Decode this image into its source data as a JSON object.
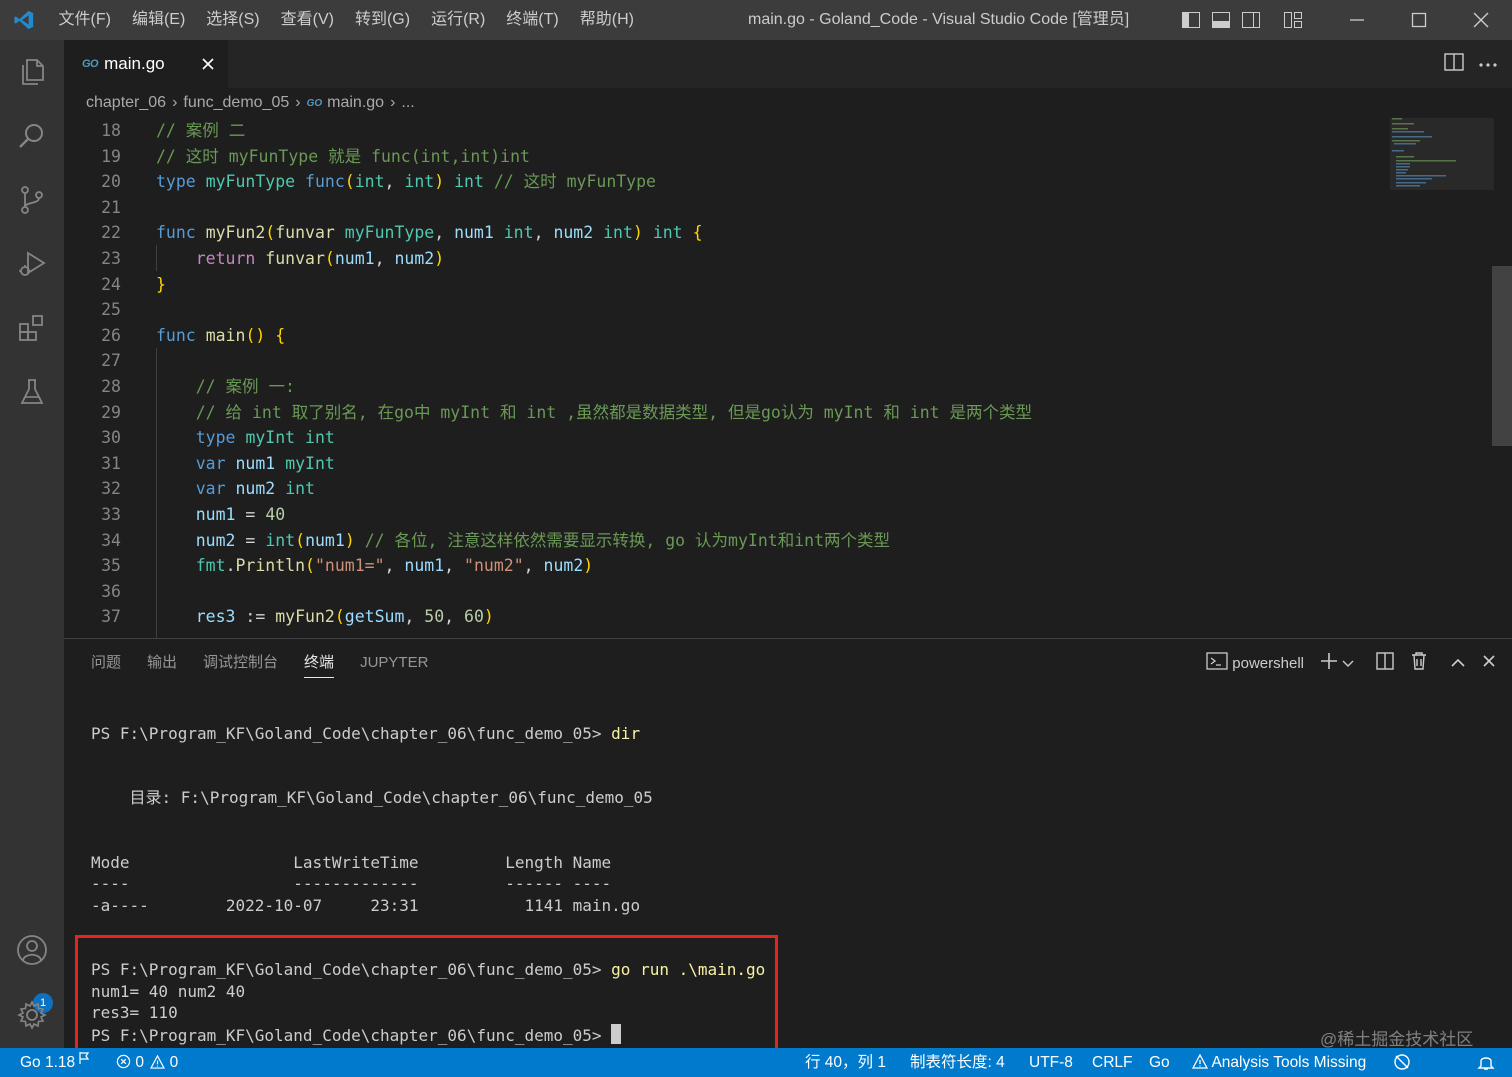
{
  "titlebar": {
    "menu": [
      "文件(F)",
      "编辑(E)",
      "选择(S)",
      "查看(V)",
      "转到(G)",
      "运行(R)",
      "终端(T)",
      "帮助(H)"
    ],
    "title": "main.go - Goland_Code - Visual Studio Code [管理员]"
  },
  "activitybar": {
    "badge": "1"
  },
  "tab": {
    "icon": "GO",
    "label": "main.go"
  },
  "breadcrumb": {
    "parts": [
      "chapter_06",
      "func_demo_05",
      "main.go",
      "..."
    ]
  },
  "editor": {
    "line_numbers": [
      "18",
      "19",
      "20",
      "21",
      "22",
      "23",
      "24",
      "25",
      "26",
      "27",
      "28",
      "29",
      "30",
      "31",
      "32",
      "33",
      "34",
      "35",
      "36",
      "37"
    ],
    "lines": [
      "// 案例 二",
      "// 这时 myFunType 就是 func(int,int)int",
      "type myFunType func(int, int) int // 这时 myFunType",
      "",
      "func myFun2(funvar myFunType, num1 int, num2 int) int {",
      "    return funvar(num1, num2)",
      "}",
      "",
      "func main() {",
      "",
      "    // 案例 一:",
      "    // 给 int 取了别名, 在go中 myInt 和 int ,虽然都是数据类型, 但是go认为 myInt 和 int 是两个类型",
      "    type myInt int",
      "    var num1 myInt",
      "    var num2 int",
      "    num1 = 40",
      "    num2 = int(num1) // 各位, 注意这样依然需要显示转换, go 认为myInt和int两个类型",
      "    fmt.Println(\"num1=\", num1, \"num2\", num2)",
      "",
      "    res3 := myFun2(getSum, 50, 60)"
    ]
  },
  "panel": {
    "tabs": [
      "问题",
      "输出",
      "调试控制台",
      "终端",
      "JUPYTER"
    ],
    "shell": "powershell",
    "terminal": {
      "prompt": "PS F:\\Program_KF\\Goland_Code\\chapter_06\\func_demo_05> ",
      "cmd1": "dir",
      "dir_line": "    目录: F:\\Program_KF\\Goland_Code\\chapter_06\\func_demo_05",
      "header": "Mode                 LastWriteTime         Length Name",
      "rule": "----                 -------------         ------ ----",
      "row": "-a----        2022-10-07     23:31           1141 main.go",
      "cmd2": "go run .\\main.go",
      "out1": "num1= 40 num2 40",
      "out2": "res3= 110"
    }
  },
  "statusbar": {
    "go_version": "Go 1.18",
    "errors": "0",
    "warnings": "0",
    "position": "行 40，列 1",
    "tab_size": "制表符长度: 4",
    "encoding": "UTF-8",
    "eol": "CRLF",
    "language": "Go",
    "analysis": "Analysis Tools Missing"
  },
  "watermark": "@稀土掘金技术社区",
  "colors": {
    "accent": "#007acc",
    "highlight_box": "#e8231f"
  }
}
